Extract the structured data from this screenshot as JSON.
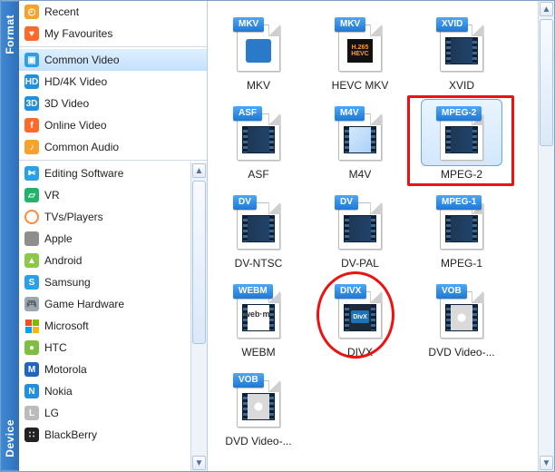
{
  "side_tabs": {
    "format": "Format",
    "device": "Device"
  },
  "sidebar": {
    "top": [
      {
        "label": "Recent",
        "icon": "clock-icon",
        "cls": "ic-recent"
      },
      {
        "label": "My Favourites",
        "icon": "heart-icon",
        "cls": "ic-fav"
      }
    ],
    "format": [
      {
        "label": "Common Video",
        "icon": "film-icon",
        "cls": "ic-common",
        "selected": true
      },
      {
        "label": "HD/4K Video",
        "icon": "hd-icon",
        "cls": "ic-hd"
      },
      {
        "label": "3D Video",
        "icon": "threed-icon",
        "cls": "ic-3d"
      },
      {
        "label": "Online Video",
        "icon": "globe-icon",
        "cls": "ic-online"
      },
      {
        "label": "Common Audio",
        "icon": "music-icon",
        "cls": "ic-audio"
      }
    ],
    "device": [
      {
        "label": "Editing Software",
        "icon": "scissors-icon",
        "cls": "ic-edit"
      },
      {
        "label": "VR",
        "icon": "vr-icon",
        "cls": "ic-vr"
      },
      {
        "label": "TVs/Players",
        "icon": "tv-icon",
        "cls": "ic-tv"
      },
      {
        "label": "Apple",
        "icon": "apple-icon",
        "cls": "ic-apple"
      },
      {
        "label": "Android",
        "icon": "android-icon",
        "cls": "ic-android"
      },
      {
        "label": "Samsung",
        "icon": "samsung-icon",
        "cls": "ic-samsung"
      },
      {
        "label": "Game Hardware",
        "icon": "gamepad-icon",
        "cls": "ic-game"
      },
      {
        "label": "Microsoft",
        "icon": "microsoft-icon",
        "cls": "ic-ms"
      },
      {
        "label": "HTC",
        "icon": "htc-icon",
        "cls": "ic-htc"
      },
      {
        "label": "Motorola",
        "icon": "motorola-icon",
        "cls": "ic-moto"
      },
      {
        "label": "Nokia",
        "icon": "nokia-icon",
        "cls": "ic-nokia"
      },
      {
        "label": "LG",
        "icon": "lg-icon",
        "cls": "ic-lg"
      },
      {
        "label": "BlackBerry",
        "icon": "blackberry-icon",
        "cls": "ic-bb"
      }
    ]
  },
  "grid": [
    [
      {
        "tag": "MKV",
        "label": "MKV",
        "thumb": "matroska"
      },
      {
        "tag": "MKV",
        "label": "HEVC MKV",
        "thumb": "hevc"
      },
      {
        "tag": "XVID",
        "label": "XVID",
        "thumb": "film"
      }
    ],
    [
      {
        "tag": "ASF",
        "label": "ASF",
        "thumb": "film"
      },
      {
        "tag": "M4V",
        "label": "M4V",
        "thumb": "m4v"
      },
      {
        "tag": "MPEG-2",
        "label": "MPEG-2",
        "thumb": "film",
        "selected": true,
        "red_rect": true
      }
    ],
    [
      {
        "tag": "DV",
        "label": "DV-NTSC",
        "thumb": "film"
      },
      {
        "tag": "DV",
        "label": "DV-PAL",
        "thumb": "film"
      },
      {
        "tag": "MPEG-1",
        "label": "MPEG-1",
        "thumb": "film"
      }
    ],
    [
      {
        "tag": "WEBM",
        "label": "WEBM",
        "thumb": "webm",
        "webm_text": "web·m"
      },
      {
        "tag": "DIVX",
        "label": "DIVX",
        "thumb": "divx",
        "dx_text": "DivX",
        "red_ring": true
      },
      {
        "tag": "VOB",
        "label": "DVD Video-...",
        "thumb": "vob"
      }
    ],
    [
      {
        "tag": "VOB",
        "label": "DVD Video-...",
        "thumb": "vob"
      }
    ]
  ],
  "hevc": {
    "line1": "H.265",
    "line2": "HEVC"
  }
}
